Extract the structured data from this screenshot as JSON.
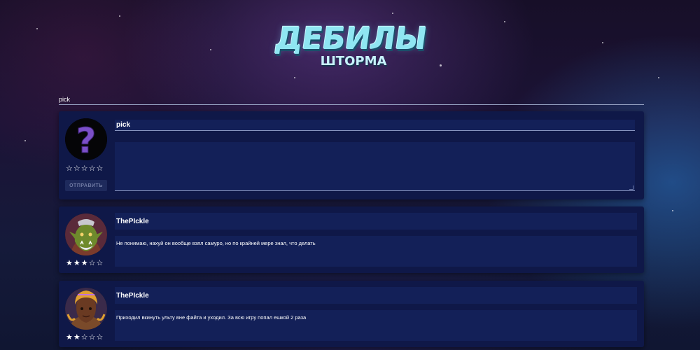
{
  "logo": {
    "title": "ДЕБИЛЫ",
    "subtitle": "ШТОРМА"
  },
  "search": {
    "value": "pick"
  },
  "new_comment": {
    "name_value": "pick",
    "text_value": "",
    "rating": "☆☆☆☆☆",
    "send_label": "ОТПРАВИТЬ"
  },
  "comments": [
    {
      "author": "ThePIckle",
      "rating": "★★★☆☆",
      "text": "Не понимаю, нахуй он вообще взял самуро, но по крайней мере знал, что делать"
    },
    {
      "author": "ThePIckle",
      "rating": "★★☆☆☆",
      "text": "Приходил вкинуть ульту вне файта и уходил. За всю игру попал ешкой 2 раза"
    }
  ]
}
